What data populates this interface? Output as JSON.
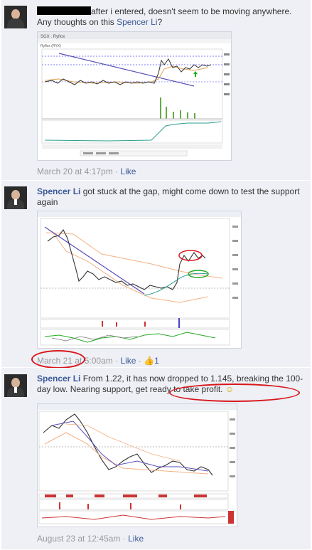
{
  "posts": [
    {
      "author": "",
      "text_before": "after i entered, doesn't seem to be moving anywhere. Any thoughts on this ",
      "mention": "Spencer Li",
      "text_after": "?",
      "timestamp": "March 20 at 4:17pm",
      "separator": "·",
      "like_label": "Like"
    },
    {
      "author": "Spencer Li",
      "text": "got stuck at the gap, might come down to test the support again",
      "timestamp_date": "March 21",
      "timestamp_time": "at 5:00am",
      "separator": "·",
      "like_label": "Like",
      "like_count": "1"
    },
    {
      "author": "Spencer Li",
      "text": "From 1.22, it has now dropped to 1.145, breaking the 100-day low. Nearing support, get ready to take profit.",
      "emoji": "☺",
      "timestamp": "August 23 at 12:45am",
      "separator": "·",
      "like_label": "Like"
    }
  ],
  "chart1": {
    "header": "SGX : Ryflox",
    "title": "Ryflox (RYX)"
  },
  "colors": {
    "link": "#3b5998",
    "post_bg": "#eef0f5",
    "annotation_red": "#d8161b"
  }
}
